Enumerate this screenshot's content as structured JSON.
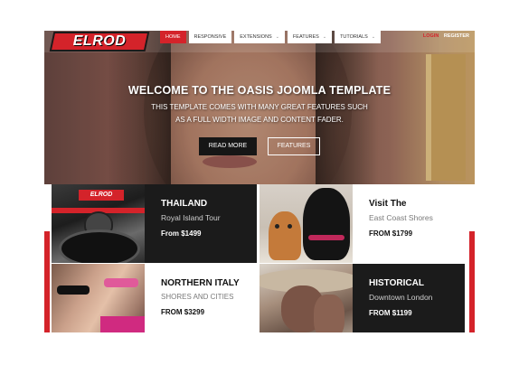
{
  "site": {
    "logo_text": "ELROD",
    "nav": [
      {
        "label": "Home",
        "active": true,
        "has_caret": false
      },
      {
        "label": "Responsive",
        "active": false,
        "has_caret": false
      },
      {
        "label": "Extensions",
        "active": false,
        "has_caret": true
      },
      {
        "label": "Features",
        "active": false,
        "has_caret": true
      },
      {
        "label": "Tutorials",
        "active": false,
        "has_caret": true
      }
    ],
    "caret": "⌄",
    "auth": {
      "login": "Login",
      "register": "Register"
    },
    "accent_color": "#d4232a"
  },
  "hero": {
    "title": "WELCOME TO THE OASIS JOOMLA TEMPLATE",
    "subtitle_line1": "THIS TEMPLATE COMES WITH MANY GREAT FEATURES SUCH",
    "subtitle_line2": "AS A FULL WIDTH IMAGE AND CONTENT FADER.",
    "read_more": "READ MORE",
    "features": "FEATURES"
  },
  "cards": [
    {
      "title": "THAILAND",
      "subtitle": "Royal Island Tour",
      "price": "From $1499",
      "image_badge": "ELROD"
    },
    {
      "title": "Visit The",
      "subtitle": "East Coast Shores",
      "price": "FROM $1799"
    },
    {
      "title": "NORTHERN ITALY",
      "subtitle": "SHORES AND CITIES",
      "price": "FROM $3299"
    },
    {
      "title": "HISTORICAL",
      "subtitle": "Downtown London",
      "price": "FROM $1199"
    }
  ]
}
